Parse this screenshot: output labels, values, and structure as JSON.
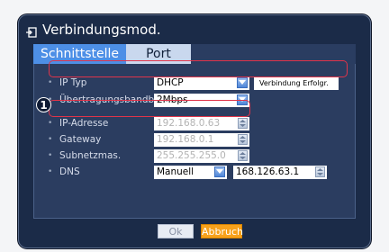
{
  "window": {
    "title": "Verbindungsmod."
  },
  "tabs": [
    {
      "label": "Schnittstelle",
      "active": true
    },
    {
      "label": "Port",
      "active": false
    }
  ],
  "fields": {
    "ip_typ": {
      "label": "IP Typ",
      "value": "DHCP",
      "status": "Verbindung Erfolgr."
    },
    "bandwidth": {
      "label": "Übertragungsbandbreite",
      "value": "2Mbps"
    },
    "ip_address": {
      "label": "IP-Adresse",
      "value": "192.168.0.63"
    },
    "gateway": {
      "label": "Gateway",
      "value": "192.168.0.1"
    },
    "subnet": {
      "label": "Subnetzmas.",
      "value": "255.255.255.0"
    },
    "dns": {
      "label": "DNS",
      "mode": "Manuell",
      "value": "168.126.63.1"
    }
  },
  "bullet": "•",
  "callout": {
    "number": "1"
  },
  "buttons": {
    "ok": "Ok",
    "cancel": "Abbruch"
  },
  "colors": {
    "accent": "#4d8fe6",
    "highlight": "#e0344a",
    "cancel": "#f7a11b"
  }
}
